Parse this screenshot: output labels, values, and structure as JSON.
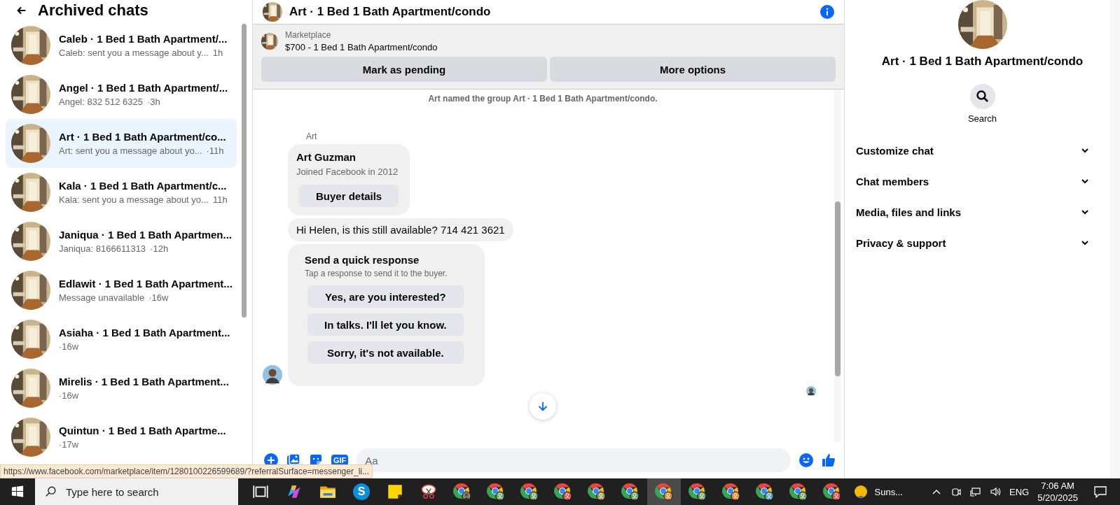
{
  "sidebar": {
    "title": "Archived chats",
    "chats": [
      {
        "name": "Caleb · 1 Bed 1 Bath Apartment/...",
        "preview": "Caleb: sent you a message about y...",
        "time": "1h",
        "selected": false
      },
      {
        "name": "Angel · 1 Bed 1 Bath Apartment/...",
        "preview": "Angel: 832 512 6325",
        "time": "·3h",
        "selected": false
      },
      {
        "name": "Art · 1 Bed 1 Bath Apartment/co...",
        "preview": "Art: sent you a message about yo...",
        "time": "·11h",
        "selected": true
      },
      {
        "name": "Kala · 1 Bed 1 Bath Apartment/c...",
        "preview": "Kala: sent you a message about yo...",
        "time": "11h",
        "selected": false
      },
      {
        "name": "Janiqua · 1 Bed 1 Bath Apartmen...",
        "preview": "Janiqua: 8166611313",
        "time": "·12h",
        "selected": false
      },
      {
        "name": "Edlawit · 1 Bed 1 Bath Apartment...",
        "preview": "Message unavailable",
        "time": "·16w",
        "selected": false
      },
      {
        "name": "Asiaha · 1 Bed 1 Bath Apartment...",
        "time": "·16w",
        "selected": false
      },
      {
        "name": "Mirelis · 1 Bed 1 Bath Apartment...",
        "time": "·16w",
        "selected": false
      },
      {
        "name": "Quintun · 1 Bed 1 Bath Apartme...",
        "time": "·17w",
        "selected": false
      }
    ]
  },
  "chat": {
    "title": "Art · 1 Bed 1 Bath Apartment/condo",
    "marketplace": {
      "label": "Marketplace",
      "listing": "$700 - 1 Bed 1 Bath Apartment/condo"
    },
    "actions": [
      "Mark as pending",
      "More options"
    ],
    "system_note": "Art named the group Art · 1 Bed 1 Bath Apartment/condo.",
    "sender": "Art",
    "profile": {
      "name": "Art Guzman",
      "subtitle": "Joined Facebook in 2012",
      "button": "Buyer details"
    },
    "message": "Hi Helen, is this still available? 714 421 3621",
    "quick_response": {
      "title": "Send a quick response",
      "subtitle": "Tap a response to send it to the buyer.",
      "options": [
        "Yes, are you interested?",
        "In talks. I'll let you know.",
        "Sorry, it's not available."
      ]
    },
    "composer": {
      "placeholder": "Aa",
      "gif": "GIF"
    }
  },
  "right_panel": {
    "title": "Art · 1 Bed 1 Bath Apartment/condo",
    "search_label": "Search",
    "sections": [
      {
        "label": "Customize chat",
        "expanded": false
      },
      {
        "label": "Chat members",
        "expanded": false
      },
      {
        "label": "Media, files and links",
        "expanded": false
      },
      {
        "label": "Privacy & support",
        "expanded": false
      }
    ]
  },
  "status_url": "https://www.facebook.com/marketplace/item/1280100226599689/?referralSurface=messenger_li...",
  "taskbar": {
    "search_placeholder": "Type here to search",
    "apps": [
      {
        "kind": "task_view"
      },
      {
        "kind": "copilot"
      },
      {
        "kind": "folder"
      },
      {
        "kind": "skype",
        "letter": "S"
      },
      {
        "kind": "notes"
      },
      {
        "kind": "snip"
      },
      {
        "kind": "browser_photo",
        "selected": false
      },
      {
        "kind": "browser",
        "color": "#6aa86a",
        "selected": false
      },
      {
        "kind": "browser",
        "color": "#6aa86a",
        "selected": false
      },
      {
        "kind": "browser",
        "color": "#e0504a",
        "selected": false
      },
      {
        "kind": "browser",
        "color": "#a09a5a",
        "selected": false
      },
      {
        "kind": "browser",
        "color": "#6aa86a",
        "selected": false
      },
      {
        "kind": "browser",
        "color": "#e08a3a",
        "selected": true
      },
      {
        "kind": "browser",
        "color": "#6aa86a",
        "selected": false
      },
      {
        "kind": "browser",
        "color": "#e08a3a",
        "selected": false
      },
      {
        "kind": "browser",
        "color": "#5aa0c8",
        "selected": false
      },
      {
        "kind": "browser",
        "color": "#6aa86a",
        "selected": false
      },
      {
        "kind": "browser",
        "color": "#e0504a",
        "selected": false
      }
    ],
    "weather": "Suns...",
    "language": "ENG",
    "time": "7:06 AM",
    "date": "5/20/2025"
  }
}
